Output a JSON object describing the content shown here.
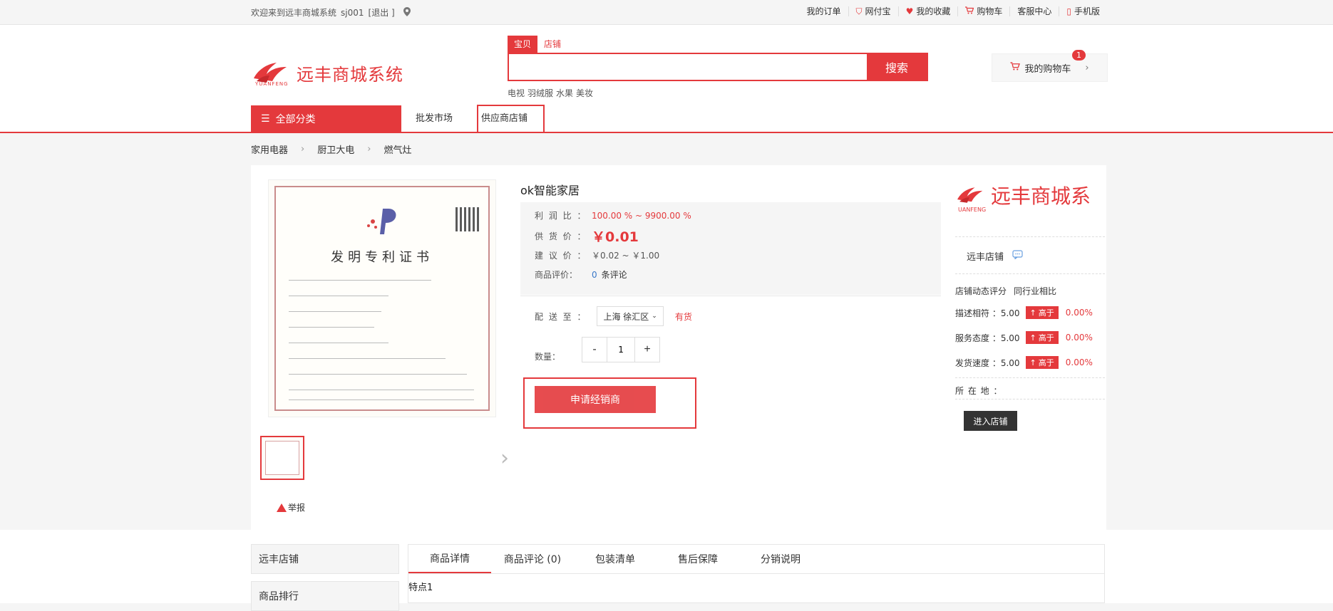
{
  "topbar": {
    "welcome": "欢迎来到远丰商城系统",
    "user": "sj001",
    "logout": "[退出 ]",
    "links": [
      "我的订单",
      "网付宝",
      "我的收藏",
      "购物车",
      "客服中心",
      "手机版"
    ]
  },
  "header": {
    "logo_text": "远丰商城系统",
    "logo_sub": "YUANFENG",
    "search_tabs": [
      "宝贝",
      "店铺"
    ],
    "search_value": "",
    "search_button": "搜索",
    "hot_words": [
      "电视",
      "羽绒服",
      "水果",
      "美妆"
    ],
    "cart_label": "我的购物车",
    "cart_count": "1"
  },
  "nav": {
    "all_categories": "全部分类",
    "links": [
      "批发市场",
      "供应商店铺"
    ]
  },
  "breadcrumb": [
    "家用电器",
    "厨卫大电",
    "燃气灶"
  ],
  "product": {
    "title": "ok智能家居",
    "cert_title": "发明专利证书",
    "profit_label": "利 润 比 ：",
    "profit_value": "100.00 % ~ 9900.00 %",
    "supply_label": "供 货 价 ：",
    "supply_value": "￥0.01",
    "suggest_label": "建 议 价 ：",
    "suggest_value": "￥0.02 ~ ￥1.00",
    "review_label": "商品评价：",
    "review_count": "0",
    "review_unit": "条评论",
    "deliver_label": "配 送 至 ：",
    "region": "上海 徐汇区",
    "stock": "有货",
    "qty_label": "数量：",
    "qty_value": "1",
    "minus": "-",
    "plus": "+",
    "apply_button": "申请经销商",
    "report": "举报"
  },
  "shop": {
    "logo_text": "远丰商城系",
    "logo_sub": "UANFENG",
    "name": "远丰店铺",
    "score_head": [
      "店铺动态评分",
      "同行业相比"
    ],
    "scores": [
      {
        "label": "描述相符 ：5.00",
        "tag": "高于",
        "pct": "0.00%"
      },
      {
        "label": "服务态度 ：5.00",
        "tag": "高于",
        "pct": "0.00%"
      },
      {
        "label": "发货速度 ：5.00",
        "tag": "高于",
        "pct": "0.00%"
      }
    ],
    "location_label": "所 在 地 ：",
    "enter_button": "进入店铺"
  },
  "bottom": {
    "side_items": [
      "远丰店铺",
      "商品排行"
    ],
    "tabs": [
      "商品详情",
      "商品评论 (0)",
      "包装清单",
      "售后保障",
      "分销说明"
    ],
    "content": "特点1"
  },
  "colors": {
    "accent": "#e4393c"
  }
}
